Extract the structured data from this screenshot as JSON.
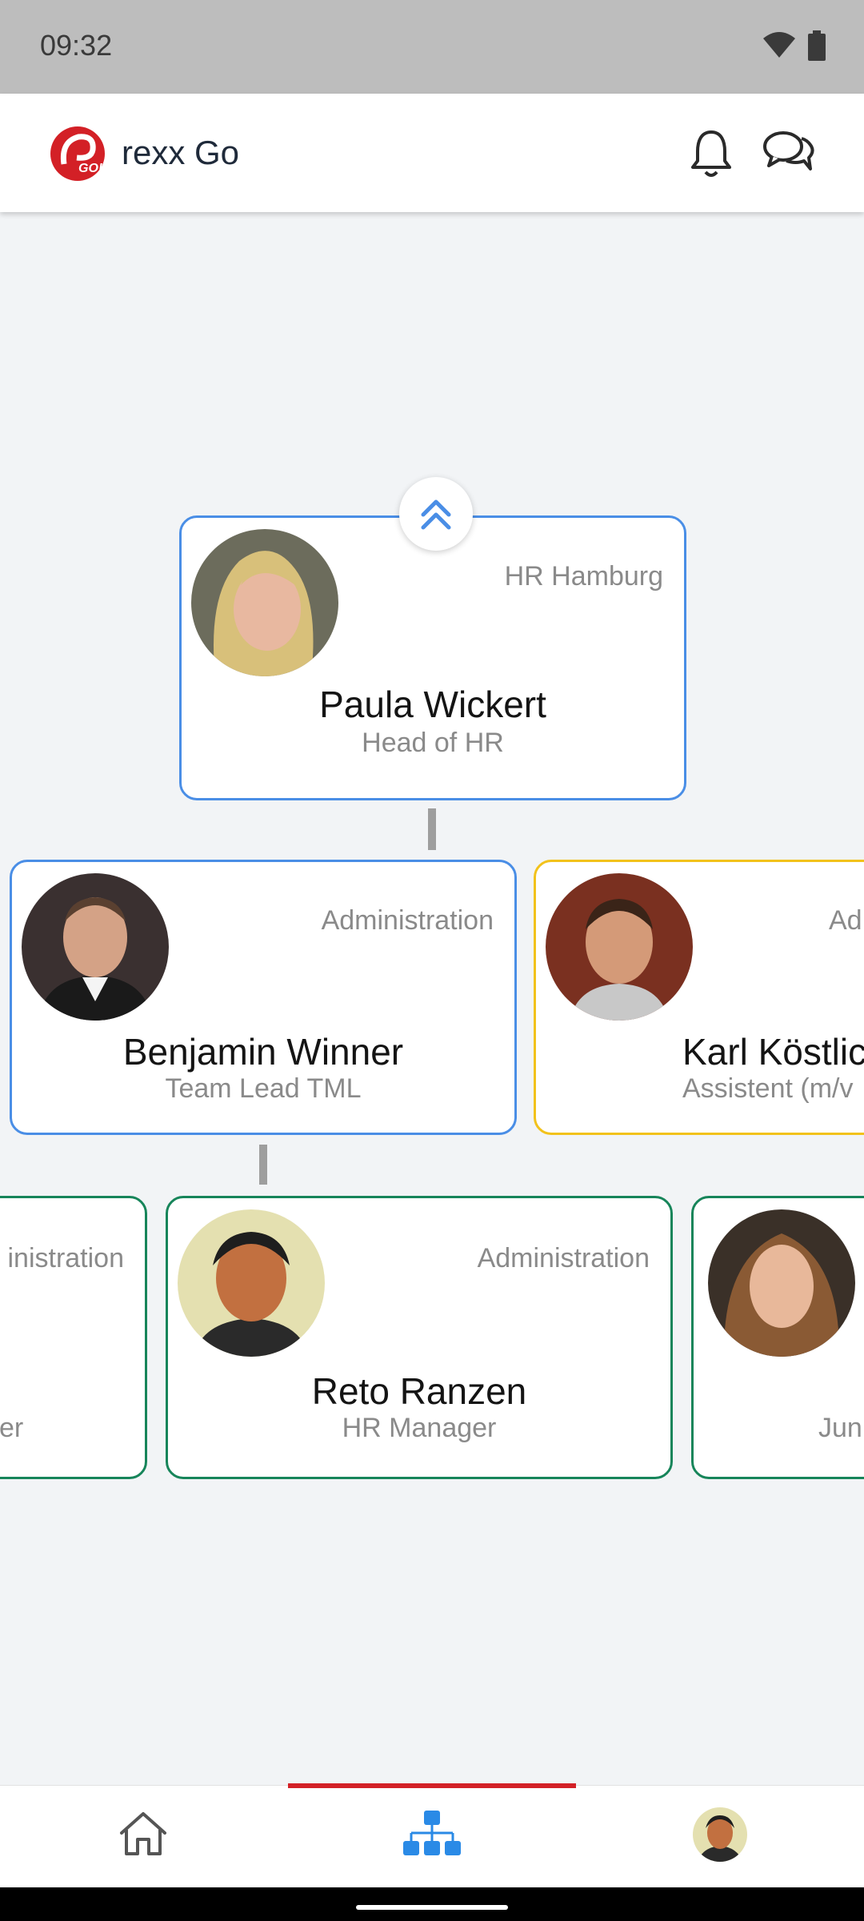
{
  "status_bar": {
    "time": "09:32",
    "icons": [
      "wifi-icon",
      "battery-icon"
    ]
  },
  "app_bar": {
    "title": "rexx Go",
    "logo_text": "GO!",
    "icons": [
      "bell-icon",
      "chat-icon"
    ]
  },
  "org_chart": {
    "top": {
      "name": "Paula Wickert",
      "role": "Head of HR",
      "department": "HR Hamburg"
    },
    "middle": [
      {
        "name": "Benjamin Winner",
        "role": "Team Lead TML",
        "department": "Administration"
      },
      {
        "name": "Karl Köstlic",
        "role": "Assistent (m/v",
        "department": "Ad"
      }
    ],
    "bottom": [
      {
        "name": "",
        "role": "er",
        "department": "inistration"
      },
      {
        "name": "Reto Ranzen",
        "role": "HR Manager",
        "department": "Administration"
      },
      {
        "name": "",
        "role": "Jun",
        "department": ""
      }
    ]
  },
  "bottom_nav": {
    "items": [
      "home-icon",
      "org-chart-icon",
      "profile-avatar"
    ],
    "active_index": 1
  },
  "colors": {
    "accent": "#d32026",
    "blue": "#4a8ee6",
    "yellow": "#f2c21b",
    "green": "#17855a"
  }
}
